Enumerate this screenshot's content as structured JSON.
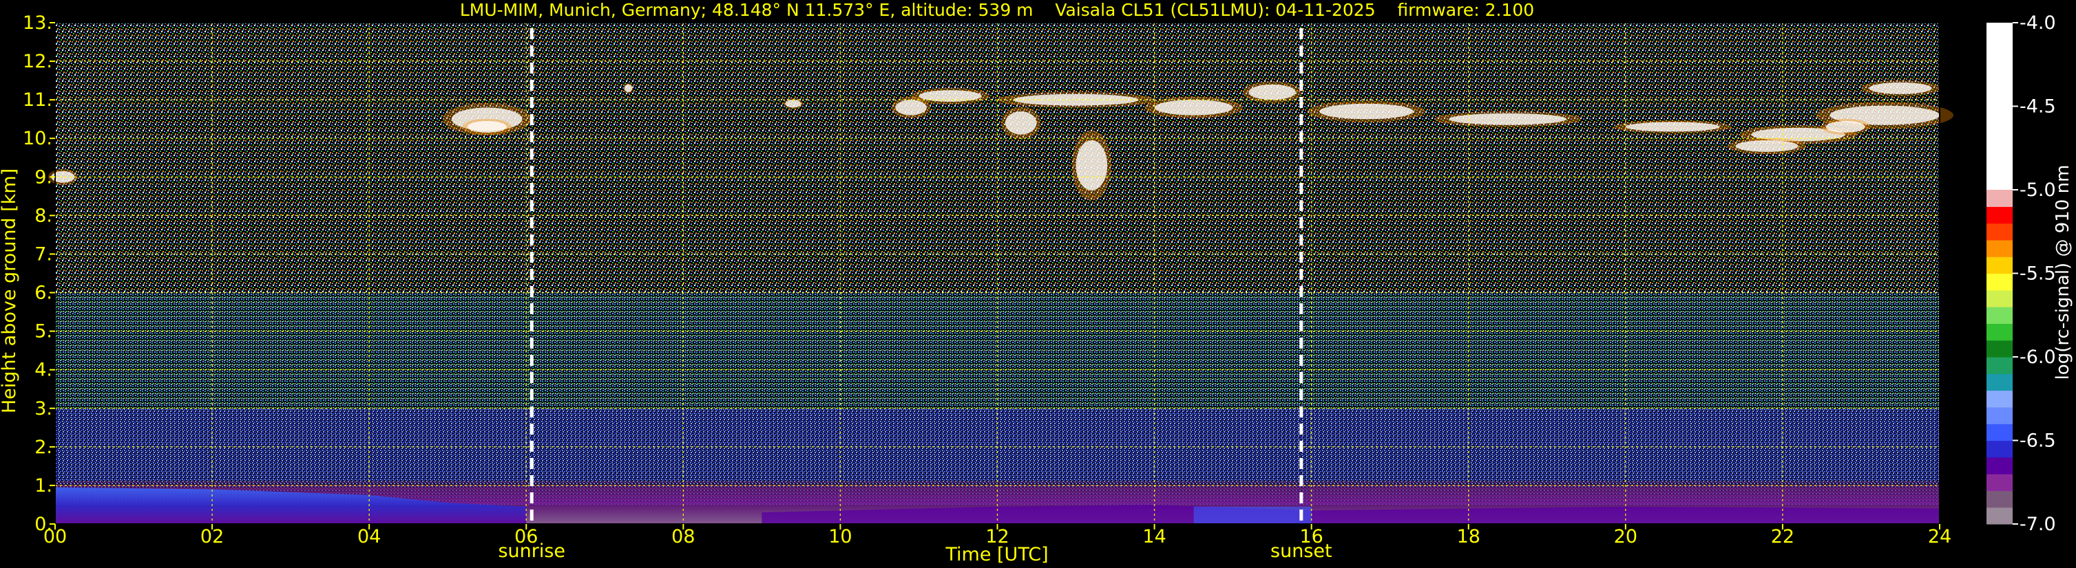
{
  "chart_data": {
    "type": "heatmap",
    "title": "LMU-MIM, Munich, Germany; 48.148° N 11.573° E, altitude: 539 m    Vaisala CL51 (CL51LMU): 04-11-2025    firmware: 2.100",
    "xlabel": "Time [UTC]",
    "ylabel": "Height above ground [km]",
    "xlim": [
      0,
      24
    ],
    "ylim": [
      0,
      13
    ],
    "x_ticks": [
      0,
      2,
      4,
      6,
      8,
      10,
      12,
      14,
      16,
      18,
      20,
      22,
      24
    ],
    "x_tick_labels": [
      "00",
      "02",
      "04",
      "06",
      "08",
      "10",
      "12",
      "14",
      "16",
      "18",
      "20",
      "22",
      "24"
    ],
    "y_ticks": [
      0,
      1,
      2,
      3,
      4,
      5,
      6,
      7,
      8,
      9,
      10,
      11,
      12,
      13
    ],
    "y_tick_labels": [
      "0.",
      "1.",
      "2.",
      "3.",
      "4.",
      "5.",
      "6.",
      "7.",
      "8.",
      "9.",
      "10.",
      "11.",
      "12.",
      "13."
    ],
    "grid": true,
    "colorbar": {
      "label": "log(rc-signal) @ 910 nm",
      "range": [
        -7.0,
        -4.0
      ],
      "ticks": [
        -7.0,
        -6.5,
        -6.0,
        -5.5,
        -5.0,
        -4.5,
        -4.0
      ],
      "tick_labels": [
        "-7.0",
        "-6.5",
        "-6.0",
        "-5.5",
        "-5.0",
        "-4.5",
        "-4.0"
      ],
      "colors": [
        "#9a8a9a",
        "#7a5a7a",
        "#8a2a9a",
        "#5a00a0",
        "#2a2ad0",
        "#3a5aff",
        "#6a8aff",
        "#8aaaff",
        "#1a9aaa",
        "#20a060",
        "#10801a",
        "#30c030",
        "#7ae060",
        "#d0f050",
        "#ffff30",
        "#ffd000",
        "#ff9000",
        "#ff4000",
        "#ff0000",
        "#f0b0b0",
        "#ffffff"
      ]
    },
    "annotations": [
      {
        "label": "sunrise",
        "time": 6.07
      },
      {
        "label": "sunset",
        "time": 15.87
      }
    ]
  },
  "colors": {
    "text": "#ffff00",
    "background": "#000000",
    "grid": "#ffff00",
    "colorbar_text": "#ffffff"
  }
}
